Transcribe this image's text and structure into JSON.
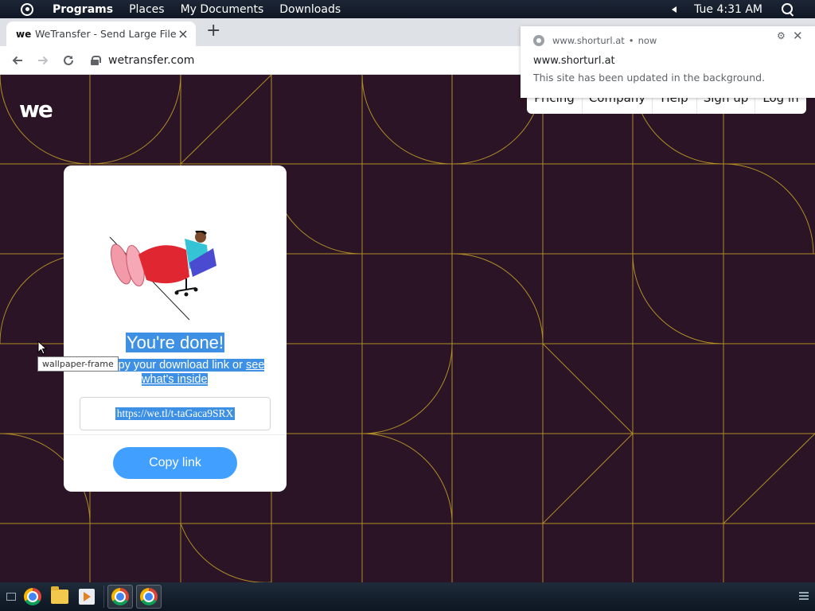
{
  "desktop": {
    "menu": [
      "Programs",
      "Places",
      "My Documents",
      "Downloads"
    ],
    "clock": "Tue 4:31 AM"
  },
  "browser": {
    "tab": {
      "favicon": "we",
      "title": "WeTransfer - Send Large Files & Sha",
      "close": "×"
    },
    "newtab": "+",
    "url": "wetransfer.com"
  },
  "site": {
    "logo": "we",
    "nav": [
      "Pricing",
      "Company",
      "Help",
      "Sign up",
      "Log in"
    ],
    "card": {
      "title": "You're done!",
      "subtitle_part1": "Copy your download link or ",
      "subtitle_link": "see",
      "subtitle_line2": "what's inside",
      "link": "https://we.tl/t-taGaca9SRX",
      "copy_button": "Copy link"
    },
    "tooltip": "wallpaper-frame"
  },
  "notification": {
    "source": "www.shorturl.at",
    "dot": "•",
    "time": "now",
    "title": "www.shorturl.at",
    "message": "This site has been updated in the background.",
    "gear": "⚙",
    "close": "✕"
  },
  "colors": {
    "page_bg": "#2a1425",
    "grid_line": "#c9a227",
    "accent": "#409fff",
    "selection": "#3d90e4"
  },
  "icons": [
    "activities-icon",
    "search-icon",
    "back-icon",
    "forward-icon",
    "reload-icon",
    "lock-icon",
    "chrome-icon",
    "folder-icon",
    "media-player-icon"
  ]
}
